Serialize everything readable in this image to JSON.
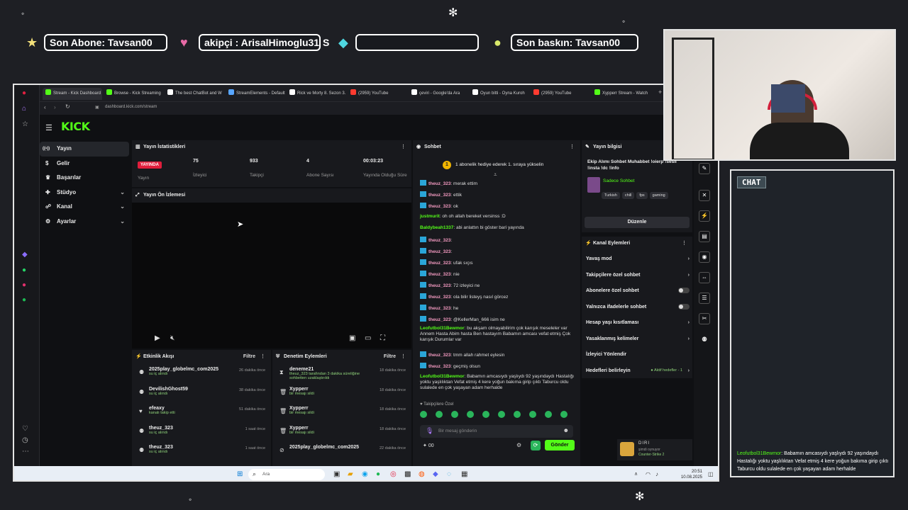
{
  "overlay": {
    "last_sub": "Son Abone: Tavsan00",
    "follower": "akipçi : ArisalHimoglu31",
    "follower_suffix": "S",
    "empty_bar": "",
    "last_raid": "Son baskın: Tavsan00",
    "chat_label": "CHAT",
    "chat_message_user": "Leofutbol31Bewmor",
    "chat_message_text": ": Babamın amcasıydı yaşlıydı 92 yaşındaydı Hastalığı yoktu yaşlılıktan Vefat etmiş 4 kere yoğun bakıma girip çıktı Taburcu oldu sulalede en çok yaşayan adam herhalde"
  },
  "browser": {
    "tabs": [
      {
        "label": "Stream - Kick Dashboard",
        "color": "#53fc18"
      },
      {
        "label": "Browse - Kick Streaming",
        "color": "#53fc18"
      },
      {
        "label": "The best ChatBot and W",
        "color": "#ffffff"
      },
      {
        "label": "StreamElements - Default",
        "color": "#58a6ff"
      },
      {
        "label": "Rick ve Morty 8. Sezon 3.",
        "color": "#ffffff"
      },
      {
        "label": "(2959) YouTube",
        "color": "#ff3b30"
      },
      {
        "label": "çeviri - Google'da Ara",
        "color": "#ffffff"
      },
      {
        "label": "Oyun bitti - Oyna Kuroh",
        "color": "#ffffff"
      },
      {
        "label": "(2959) YouTube",
        "color": "#ff3b30"
      },
      {
        "label": "Xypperr Stream - Watch",
        "color": "#53fc18"
      }
    ],
    "url": "dashboard.kick.com/stream"
  },
  "kick": {
    "logo": "KICK",
    "nav": [
      {
        "label": "Yayın",
        "icon": "broadcast-icon"
      },
      {
        "label": "Gelir",
        "icon": "dollar-icon"
      },
      {
        "label": "Başarılar",
        "icon": "trophy-icon"
      },
      {
        "label": "Stüdyo",
        "icon": "studio-icon"
      },
      {
        "label": "Kanal",
        "icon": "channel-icon"
      },
      {
        "label": "Ayarlar",
        "icon": "gear-icon"
      }
    ],
    "stats": {
      "title": "Yayın İstatistikleri",
      "live_badge": "YAYINDA",
      "live_label": "Yayın",
      "viewers_value": "75",
      "viewers_label": "İzleyici",
      "followers_value": "933",
      "followers_label": "Takipçi",
      "subs_value": "4",
      "subs_label": "Abone Sayısı",
      "uptime_value": "00:03:23",
      "uptime_label": "Yayında Olduğu Süre"
    },
    "preview_title": "Yayın Ön İzlemesi",
    "activity": {
      "title": "Etkinlik Akışı",
      "filter": "Filtre",
      "items": [
        {
          "user": "2025play_globelmc_com2025",
          "sub": "su iç alındı",
          "time": "26 dakika önce"
        },
        {
          "user": "DevilishGhost59",
          "sub": "su iç alındı",
          "time": "38 dakika önce"
        },
        {
          "user": "efeaxy",
          "sub": "kanalı takip etti",
          "time": "51 dakika önce"
        },
        {
          "user": "theuz_323",
          "sub": "su iç alındı",
          "time": "1 saat önce"
        },
        {
          "user": "theuz_323",
          "sub": "su iç alındı",
          "time": "1 saat önce"
        }
      ]
    },
    "moderation": {
      "title": "Denetim Eylemleri",
      "filter": "Filtre",
      "items": [
        {
          "user": "deneme21",
          "sub": "theuz_323 tarafından 3 dakika süreliğine sohbetten uzaklaştırıldı",
          "time": "18 dakika önce"
        },
        {
          "user": "Xypperr",
          "sub": "bir mesajı sildi",
          "time": "18 dakika önce"
        },
        {
          "user": "Xypperr",
          "sub": "bir mesajı sildi",
          "time": "18 dakika önce"
        },
        {
          "user": "Xypperr",
          "sub": "bir mesajı sildi",
          "time": "18 dakika önce"
        },
        {
          "user": "2025play_globelmc_com2025",
          "sub": "",
          "time": "22 dakika önce"
        }
      ]
    },
    "chat": {
      "title": "Sohbet",
      "pinned": "1 abonelik hediye ederek 1. sıraya yükselin",
      "messages": [
        {
          "user": "theuz_323",
          "color": "u-theuz",
          "text": ": merak ettim",
          "badge": true
        },
        {
          "user": "theuz_323",
          "color": "u-theuz",
          "text": ": ettik",
          "badge": true
        },
        {
          "user": "theuz_323",
          "color": "u-theuz",
          "text": ": ok",
          "badge": true
        },
        {
          "user": "justmurit",
          "color": "u-green",
          "text": ": oh oh allah bereket versinss :D",
          "badge": false
        },
        {
          "user": "Baldybeah1337",
          "color": "u-green",
          "text": ": abi anlattın bi göster bari yayında",
          "badge": false
        },
        {
          "user": "theuz_323",
          "color": "u-theuz",
          "text": ":",
          "badge": true
        },
        {
          "user": "theuz_323",
          "color": "u-theuz",
          "text": ":",
          "badge": true
        },
        {
          "user": "theuz_323",
          "color": "u-theuz",
          "text": ": ufak sıçıs",
          "badge": true
        },
        {
          "user": "theuz_323",
          "color": "u-theuz",
          "text": ": nie",
          "badge": true
        },
        {
          "user": "theuz_323",
          "color": "u-theuz",
          "text": ": 72 izleyici ne",
          "badge": true
        },
        {
          "user": "theuz_323",
          "color": "u-theuz",
          "text": ": ola bilir listeyş nasıl görcez",
          "badge": true
        },
        {
          "user": "theuz_323",
          "color": "u-theuz",
          "text": ": he",
          "badge": true
        },
        {
          "user": "theuz_323",
          "color": "u-theuz",
          "text": ": @KellerMan_666 isim ne",
          "badge": true
        }
      ],
      "long1_user": "Leofutbol31Bewmor",
      "long1_text": ": bu akşam olmayabilirim çok karışık meseleler var Annem Hasta Abim hasta Ben hastayım Babamın amcası vefat etmiş Çok karışık Durumlar var",
      "after": [
        {
          "user": "theuz_323",
          "text": ": tmm allah rahmet eylesin"
        },
        {
          "user": "theuz_323",
          "text": ": geçmiş olsun"
        }
      ],
      "long2_user": "Leofutbol31Bewmor",
      "long2_text": ": Babamın amcasıydı yaşlıydı 92 yaşındaydı Hastalığı yoktu yaşlılıktan Vefat etmiş 4 kere yoğun bakıma girip çıktı Taburcu oldu sulalede en çok yaşayan adam herhalde",
      "followers_only": "Takipçilere Özel",
      "input_placeholder": "Bir mesaj gönderin",
      "send": "Gönder",
      "points": "00"
    },
    "info": {
      "title": "Yayın bilgisi",
      "stream_title": "Ekip Alımı Sohbet Muhabbet !oierp !sesli !insta !dc !info",
      "category": "Sadece Sohbet",
      "tags": [
        "Turkish",
        "chill",
        "fps",
        "gaming"
      ],
      "edit": "Düzenle"
    },
    "channel_actions": {
      "title": "Kanal Eylemleri",
      "rows": [
        {
          "label": "Yavaş mod",
          "kind": "chev"
        },
        {
          "label": "Takipçilere özel sohbet",
          "kind": "chev"
        },
        {
          "label": "Abonelere özel sohbet",
          "kind": "toggle"
        },
        {
          "label": "Yalnızca ifadelerle sohbet",
          "kind": "toggle"
        },
        {
          "label": "Hesap yaşı kısıtlaması",
          "kind": "chev"
        },
        {
          "label": "Yasaklanmış kelimeler",
          "kind": "chev"
        },
        {
          "label": "İzleyici Yönlendir",
          "kind": "none"
        },
        {
          "label": "Hedefleri belirleyin",
          "kind": "goal"
        }
      ],
      "goal_status": "Aktif hedefler - 1"
    },
    "now_playing": {
      "name": "DIRI",
      "status": "şimdi oynuyor",
      "game": "Counter-Strike 2"
    }
  },
  "taskbar": {
    "search": "Ara",
    "time": "20:51",
    "date": "10.08.2025"
  }
}
